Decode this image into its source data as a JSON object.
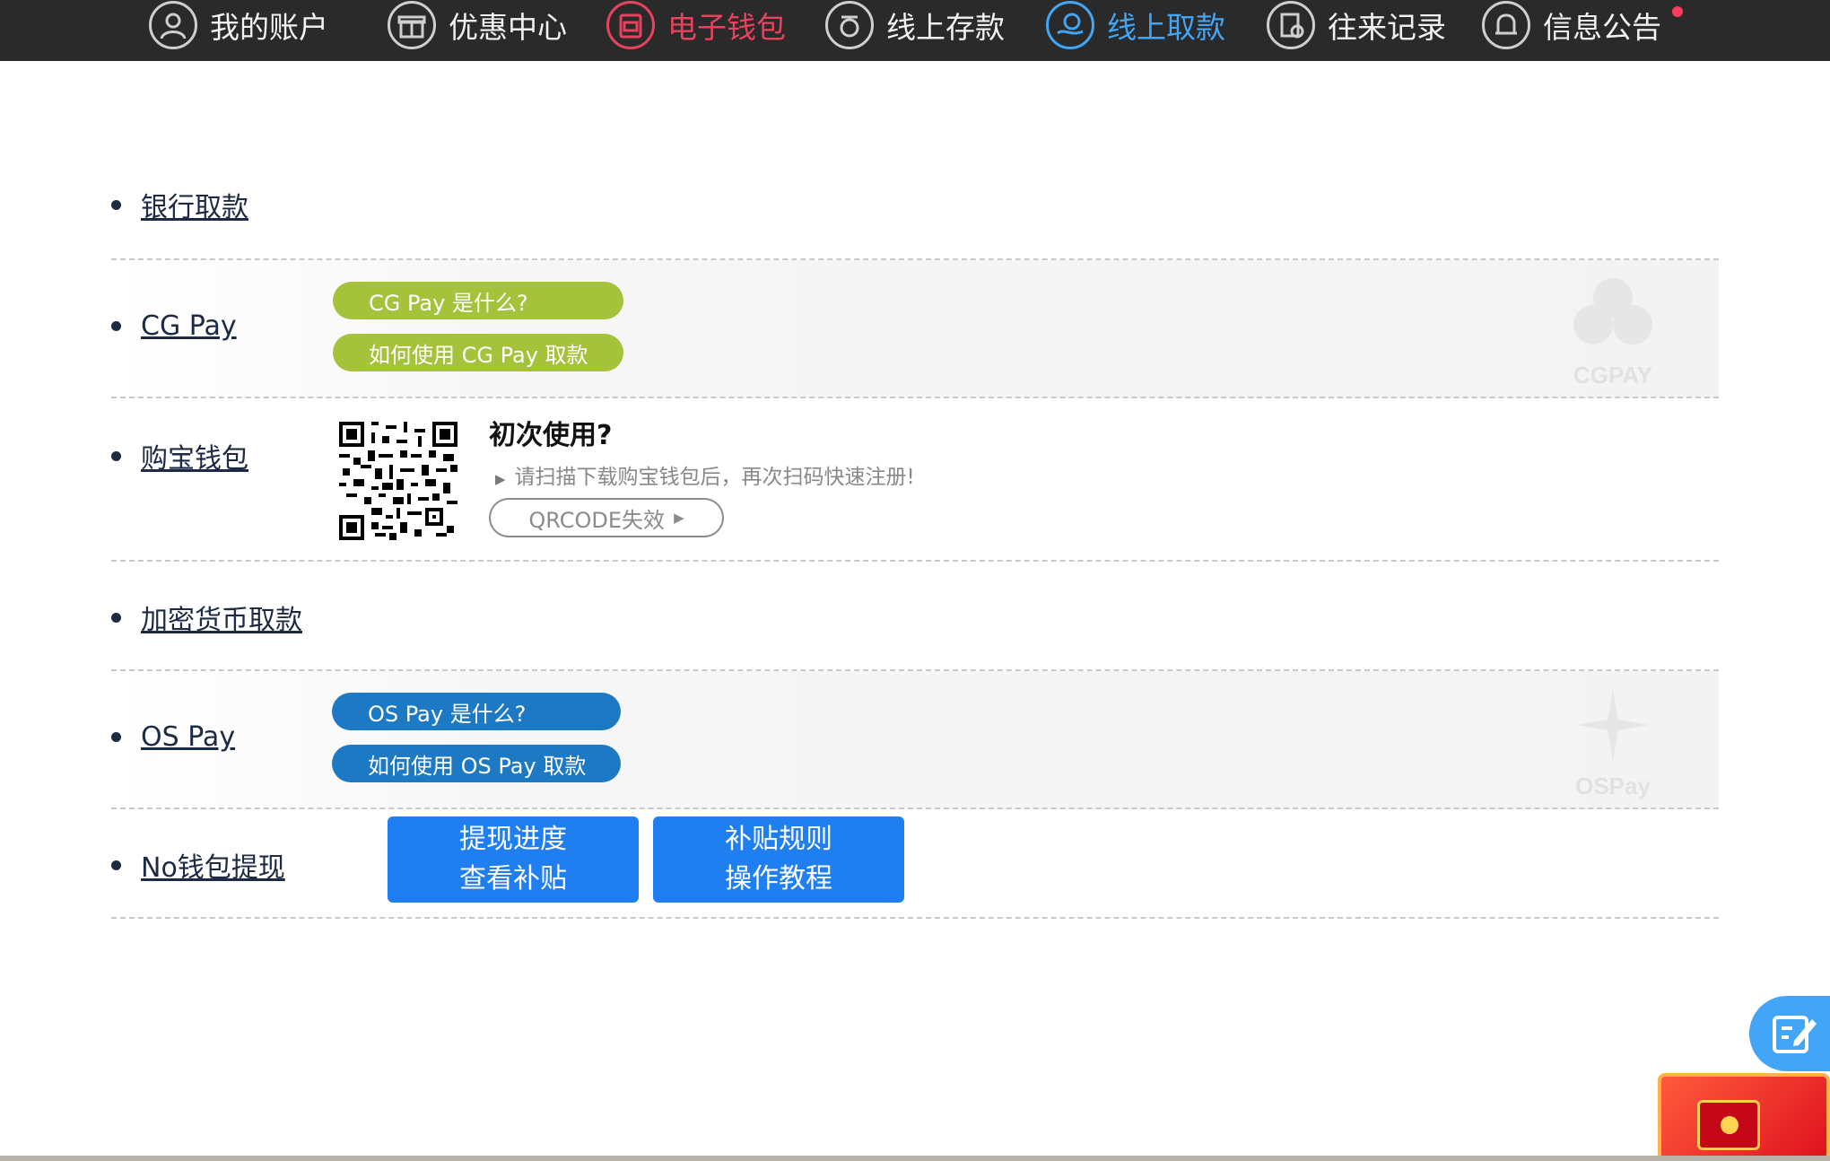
{
  "nav": {
    "items": [
      {
        "label": "我的账户",
        "icon": "user-icon"
      },
      {
        "label": "优惠中心",
        "icon": "gift-icon"
      },
      {
        "label": "电子钱包",
        "icon": "wallet-icon"
      },
      {
        "label": "线上存款",
        "icon": "deposit-icon"
      },
      {
        "label": "线上取款",
        "icon": "withdraw-icon",
        "active": true
      },
      {
        "label": "往来记录",
        "icon": "records-icon"
      },
      {
        "label": "信息公告",
        "icon": "bell-icon"
      }
    ],
    "colors": {
      "bar": "#2a2a2a",
      "wallet": "#e8435e",
      "active": "#42a5f5"
    }
  },
  "rows": {
    "bank": {
      "label": "银行取款"
    },
    "cgpay": {
      "label": "CG Pay",
      "what_is": "CG Pay 是什么?",
      "how_to": "如何使用 CG Pay 取款",
      "watermark": "CGPAY"
    },
    "goubao": {
      "label": "购宝钱包",
      "first_use_title": "初次使用?",
      "first_use_desc": "请扫描下载购宝钱包后，再次扫码快速注册!",
      "qrcode_button": "QRCODE失效"
    },
    "crypto": {
      "label": "加密货币取款"
    },
    "ospay": {
      "label": "OS Pay",
      "what_is": "OS Pay 是什么?",
      "how_to": "如何使用 OS Pay 取款",
      "watermark": "OSPay"
    },
    "nowallet": {
      "label": "No钱包提现",
      "btn1_line1": "提现进度",
      "btn1_line2": "查看补贴",
      "btn2_line1": "补贴规则",
      "btn2_line2": "操作教程"
    }
  },
  "colors": {
    "green_pill": "#a4c23a",
    "blue_pill": "#1d79c4",
    "blue_button": "#1f7ef0"
  }
}
